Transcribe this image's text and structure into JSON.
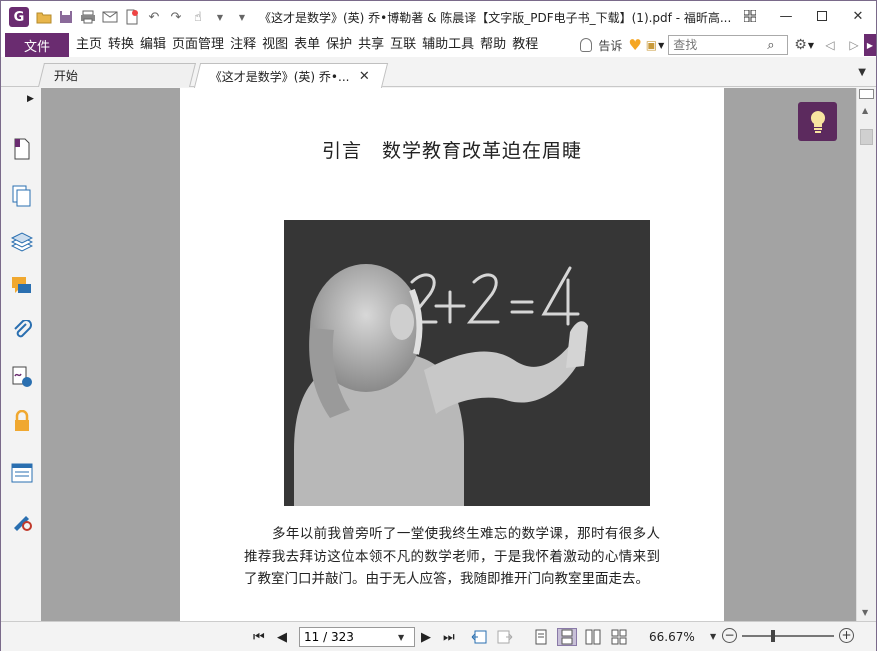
{
  "window": {
    "title": "《这才是数学》(英) 乔•博勒著 & 陈晨译【文字版_PDF电子书_下载】(1).pdf - 福昕高...",
    "app_logo": "G"
  },
  "menu": {
    "file": "文件",
    "items": [
      "主页",
      "转换",
      "编辑",
      "页面管理",
      "注释",
      "视图",
      "表单",
      "保护",
      "共享",
      "互联",
      "辅助工具",
      "帮助",
      "教程"
    ],
    "tell_me": "告诉",
    "find_placeholder": "查找"
  },
  "tabs": {
    "home": "开始",
    "doc": "《这才是数学》(英) 乔•..."
  },
  "document": {
    "heading": "引言　数学教育改革迫在眉睫",
    "paragraph": "多年以前我曾旁听了一堂使我终生难忘的数学课，那时有很多人推荐我去拜访这位本领不凡的数学老师，于是我怀着激动的心情来到了教室门口并敲门。由于无人应答，我随即推开门向教室里面走去。",
    "chalk_text": "2+2=4"
  },
  "status": {
    "page_value": "11 / 323",
    "zoom": "66.67%"
  },
  "colors": {
    "accent": "#6a2c70",
    "tip_button": "#5c2a5e"
  }
}
